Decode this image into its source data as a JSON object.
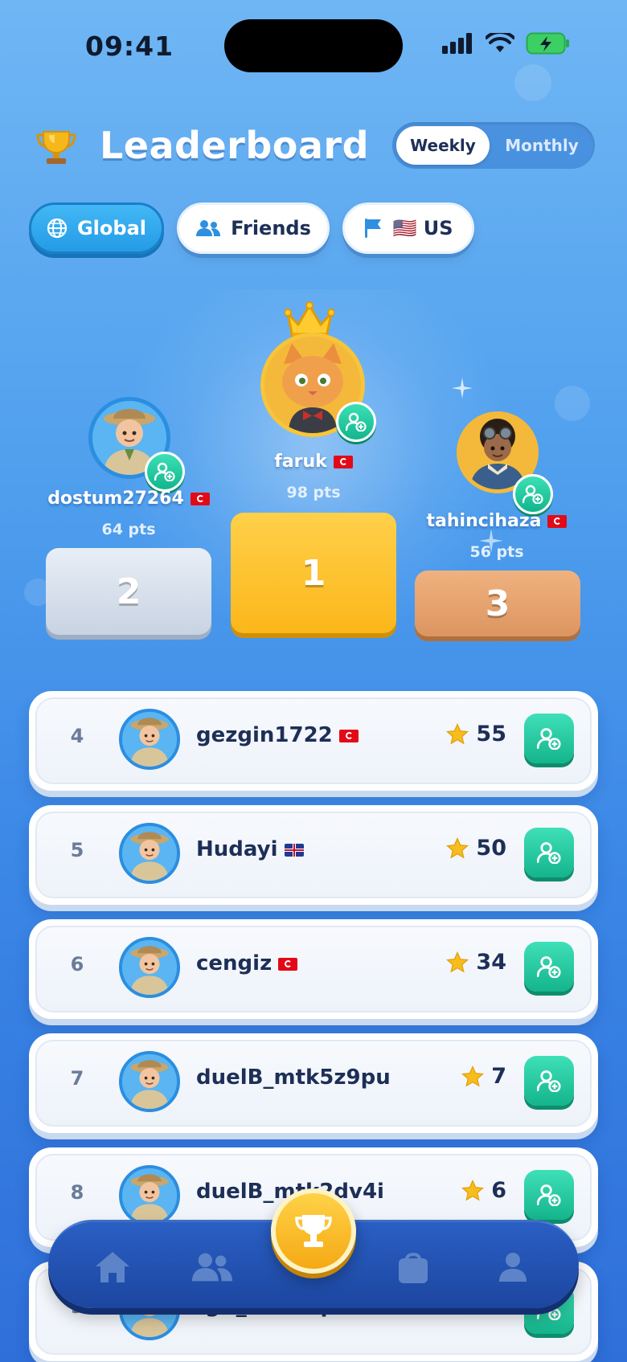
{
  "status_bar": {
    "time": "09:41"
  },
  "header": {
    "title": "Leaderboard",
    "period_options": [
      "Weekly",
      "Monthly"
    ],
    "selected_period": "Weekly"
  },
  "filters": [
    {
      "label": "Global",
      "icon": "globe-icon",
      "active": true
    },
    {
      "label": "Friends",
      "icon": "users-icon",
      "active": false
    },
    {
      "label": "🇺🇸 US",
      "icon": "flag-icon",
      "active": false
    }
  ],
  "podium": [
    {
      "rank": "1",
      "name": "faruk",
      "country": "TR",
      "points": "98 pts"
    },
    {
      "rank": "2",
      "name": "dostum27264",
      "country": "TR",
      "points": "64 pts"
    },
    {
      "rank": "3",
      "name": "tahincihaza",
      "country": "TR",
      "points": "56 pts"
    }
  ],
  "rows": [
    {
      "rank": "4",
      "name": "gezgin1722",
      "country": "TR",
      "score": "55"
    },
    {
      "rank": "5",
      "name": "Hudayi",
      "country": "GB",
      "score": "50"
    },
    {
      "rank": "6",
      "name": "cengiz",
      "country": "TR",
      "score": "34"
    },
    {
      "rank": "7",
      "name": "duelB_mtk5z9pu",
      "country": "",
      "score": "7"
    },
    {
      "rank": "8",
      "name": "duelB_mtk2dv4i",
      "country": "",
      "score": "6"
    },
    {
      "rank": "9",
      "name": "fgB_mtldzqom",
      "country": "",
      "score": "6"
    }
  ],
  "nav": {
    "items": [
      "home-icon",
      "friends-icon",
      "trophy-icon",
      "shop-icon",
      "profile-icon"
    ],
    "active": "trophy-icon"
  },
  "colors": {
    "accent_blue": "#249be6",
    "gold": "#fbb71a",
    "silver": "#c8d3e2",
    "bronze": "#dc9561",
    "add_green": "#14b48c"
  }
}
